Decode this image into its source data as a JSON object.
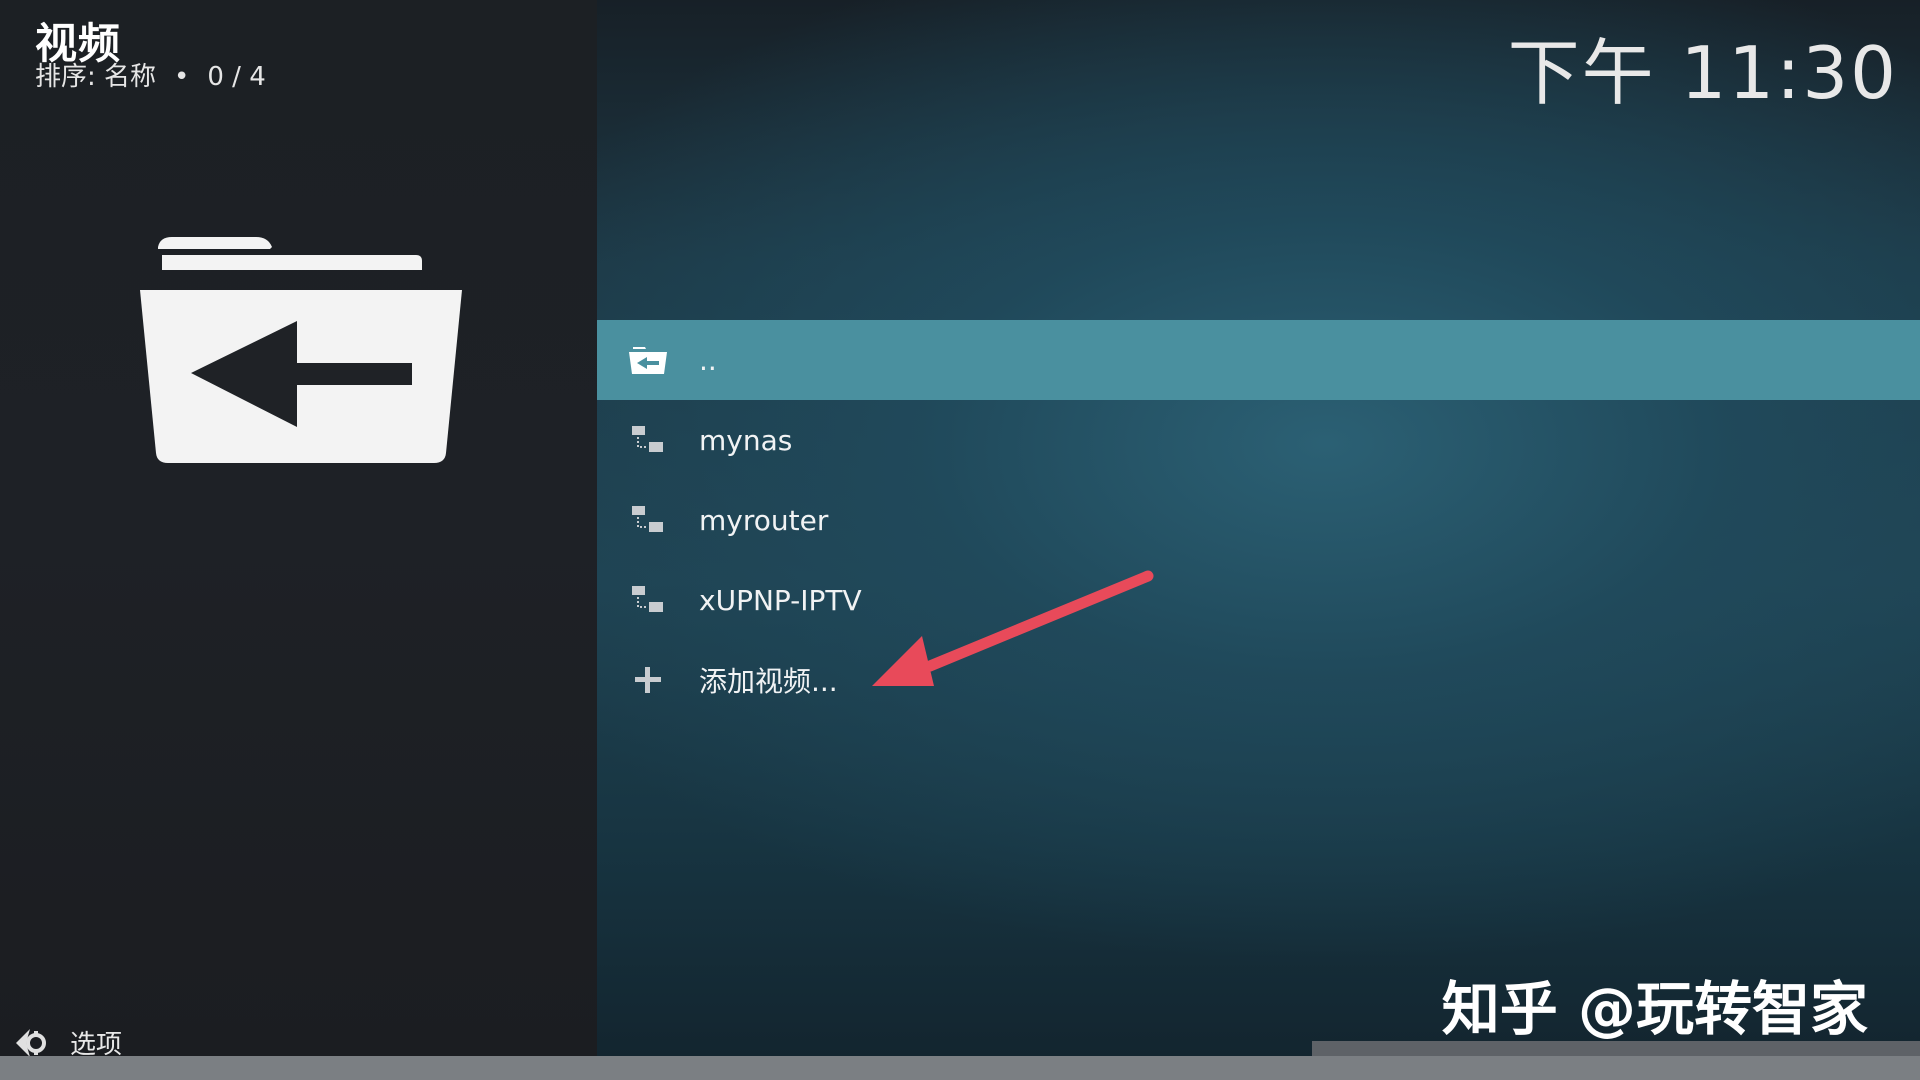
{
  "header": {
    "title": "视频",
    "sort_label": "排序: 名称",
    "separator": "•",
    "count": "0 / 4"
  },
  "clock": "下午 11:30",
  "big_icon": "folder-back-icon",
  "list": [
    {
      "label": "..",
      "icon": "folder-back-icon",
      "selected": true
    },
    {
      "label": "mynas",
      "icon": "network-icon",
      "selected": false
    },
    {
      "label": "myrouter",
      "icon": "network-icon",
      "selected": false
    },
    {
      "label": "xUPNP-IPTV",
      "icon": "network-icon",
      "selected": false
    },
    {
      "label": "添加视频...",
      "icon": "plus-icon",
      "selected": false
    }
  ],
  "options": {
    "label": "选项",
    "icon": "options-icon"
  },
  "watermark": "知乎 @玩转智家",
  "colors": {
    "selected_row": "#4a909f",
    "arrow": "#e84a5a",
    "left_panel": "#1e2126"
  }
}
